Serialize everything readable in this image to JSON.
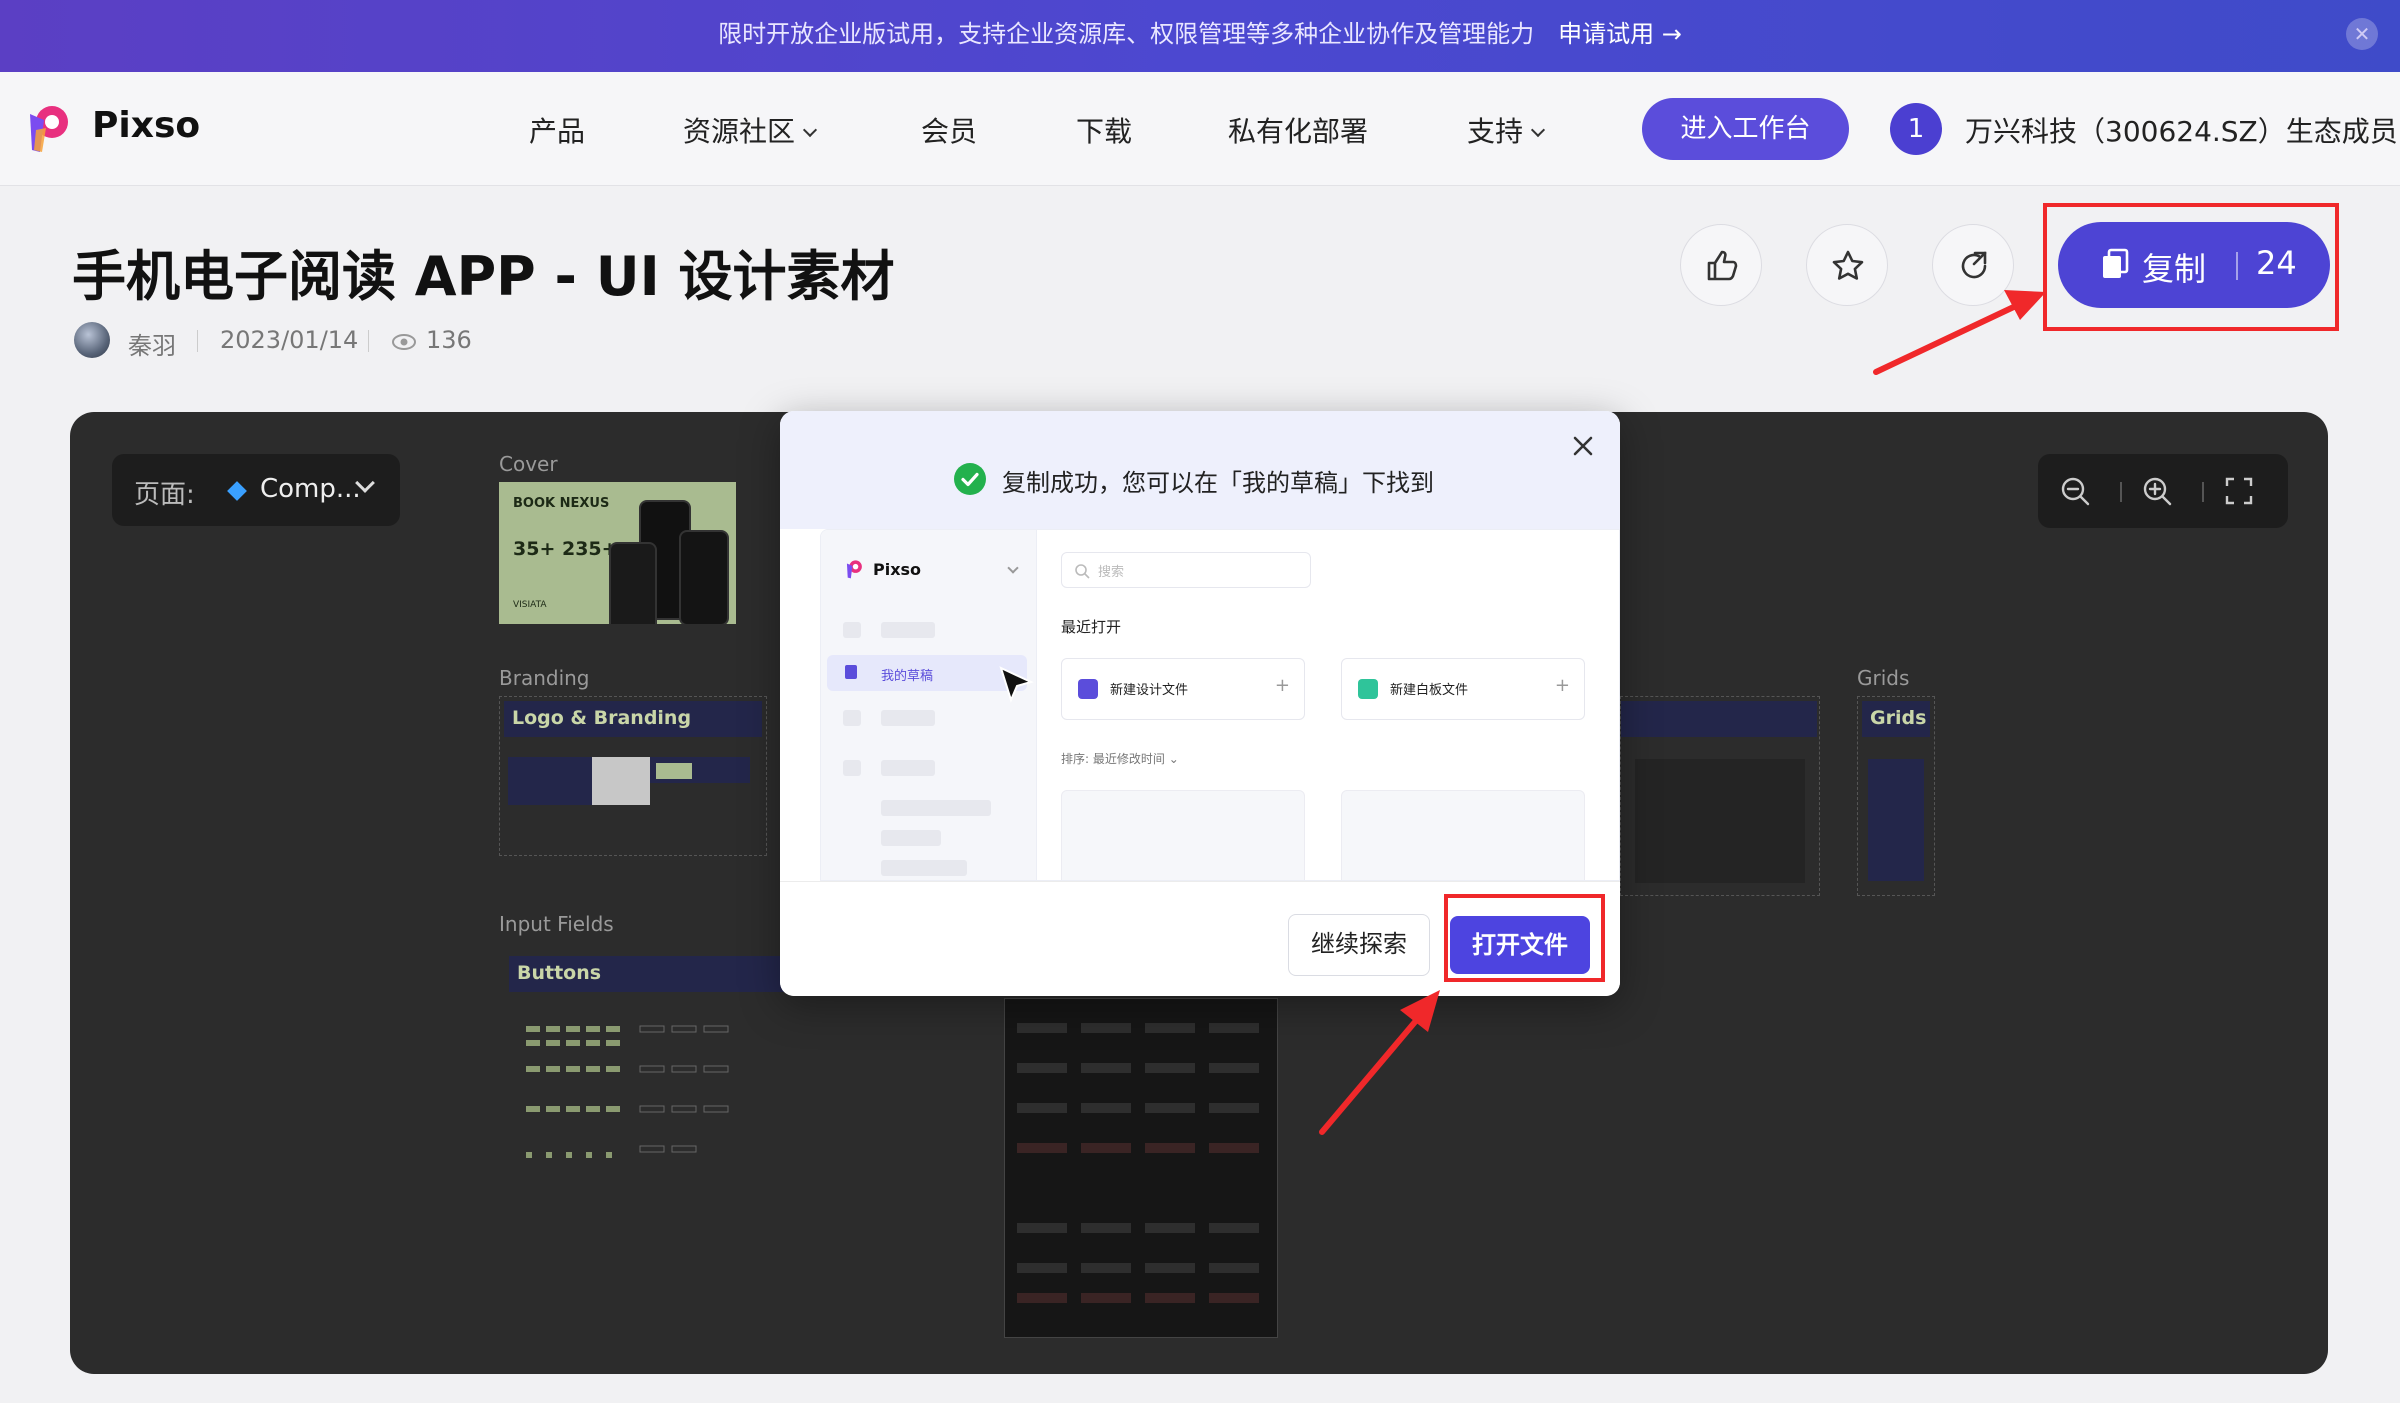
{
  "banner": {
    "text": "限时开放企业版试用，支持企业资源库、权限管理等多种企业协作及管理能力",
    "cta": "申请试用 →",
    "close_glyph": "✕"
  },
  "nav": {
    "logo_text": "Pixso",
    "items": [
      "产品",
      "资源社区",
      "会员",
      "下载",
      "私有化部署",
      "支持"
    ],
    "enter_label": "进入工作台",
    "partner_badge": "1",
    "partner_text": "万兴科技（300624.SZ）生态成员"
  },
  "resource": {
    "title": "手机电子阅读 APP - UI 设计素材",
    "author": "秦羽",
    "date": "2023/01/14",
    "views": "136",
    "copy_label": "复制",
    "copy_count": "24"
  },
  "canvas": {
    "page_label": "页面:",
    "page_value": "Comp...",
    "frames": {
      "cover": "Cover",
      "cover_brand": "BOOK NEXUS",
      "cover_stats": "35+ 235+",
      "cover_foot": "VISIATA",
      "branding": "Branding",
      "branding_head": "Logo & Branding",
      "grids": "Grids",
      "grids_head": "Grids",
      "input_fields": "Input Fields",
      "buttons_head": "Buttons"
    }
  },
  "modal": {
    "title": "复制成功，您可以在「我的草稿」下找到",
    "preview": {
      "logo": "Pixso",
      "search_placeholder": "搜索",
      "drafts": "我的草稿",
      "recent": "最近打开",
      "new_design": "新建设计文件",
      "new_board": "新建白板文件",
      "sort": "排序:",
      "sort_value": "最近修改时间"
    },
    "explore_label": "继续探索",
    "open_label": "打开文件"
  },
  "colors": {
    "accent": "#4d44d4",
    "banner": "#4c48d0",
    "success": "#23b14d",
    "highlight": "#f0282a",
    "canvas_bg": "#2c2c2c"
  }
}
